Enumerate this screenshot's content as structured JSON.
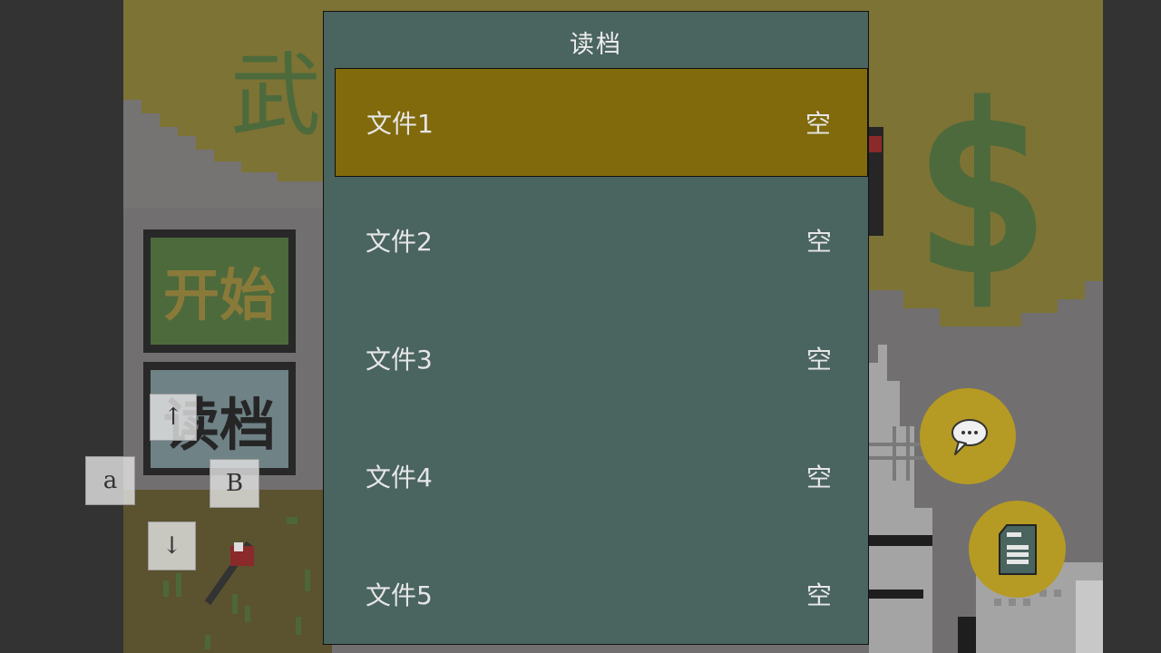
{
  "dialog": {
    "title": "读档",
    "slots": [
      {
        "name": "文件1",
        "status": "空",
        "selected": true
      },
      {
        "name": "文件2",
        "status": "空",
        "selected": false
      },
      {
        "name": "文件3",
        "status": "空",
        "selected": false
      },
      {
        "name": "文件4",
        "status": "空",
        "selected": false
      },
      {
        "name": "文件5",
        "status": "空",
        "selected": false
      }
    ]
  },
  "controls": {
    "up_key": "↑",
    "down_key": "↓",
    "a_key": "a",
    "b_key": "B"
  },
  "scene": {
    "menu_start_label": "开始",
    "menu_load_label": "读档",
    "title_fragment": "武",
    "dollar_sign": "$"
  },
  "colors": {
    "dialog_bg": "#4a6460",
    "slot_selected": "#806a0c",
    "round_button": "#b59a24"
  }
}
